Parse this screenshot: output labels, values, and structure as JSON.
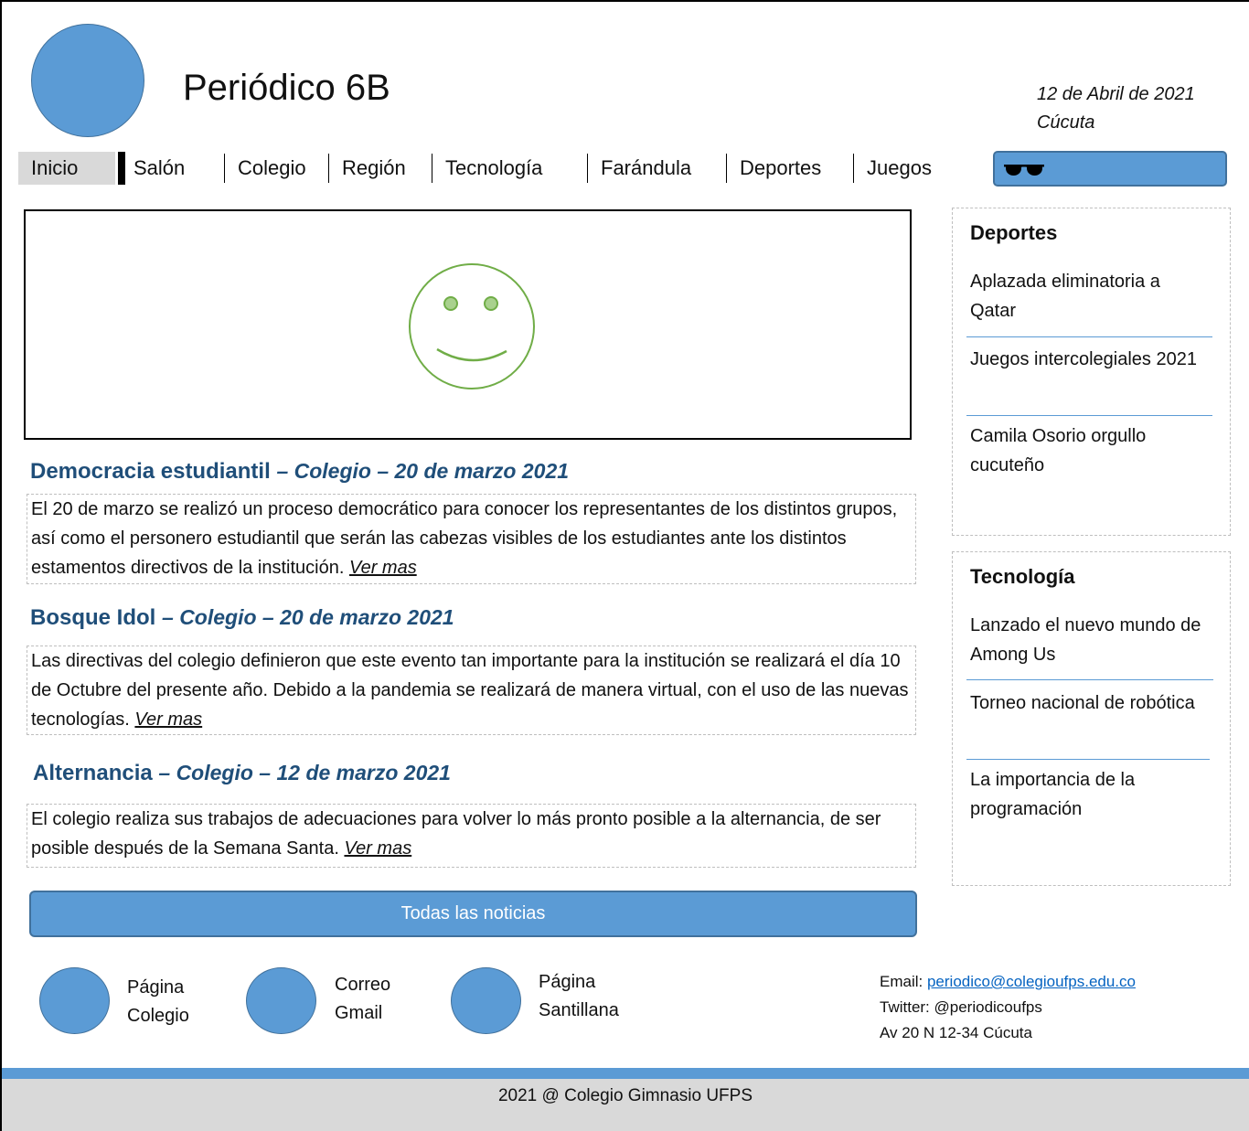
{
  "header": {
    "title": "Periódico 6B",
    "date": "12 de Abril de 2021",
    "city": "Cúcuta",
    "logo_icon": "circle-logo"
  },
  "nav": {
    "items": [
      "Inicio",
      "Salón",
      "Colegio",
      "Región",
      "Tecnología",
      "Farándula",
      "Deportes",
      "Juegos"
    ],
    "active": "Inicio"
  },
  "search": {
    "icon": "sunglasses-icon"
  },
  "hero": {
    "icon": "smiley-face-icon"
  },
  "news": [
    {
      "title": "Democracia estudiantil",
      "meta": "– Colegio – 20 de marzo 2021",
      "body": "El 20 de marzo se realizó un proceso democrático para conocer los representantes de los distintos grupos, así como el personero estudiantil que serán las cabezas visibles de los estudiantes ante los distintos estamentos directivos de la institución.",
      "more": "Ver mas"
    },
    {
      "title": "Bosque Idol",
      "meta": "– Colegio – 20 de marzo 2021",
      "body": "Las directivas del colegio definieron que este evento tan importante para la institución se realizará el día 10 de Octubre del presente año.  Debido a la pandemia se realizará de manera virtual, con el uso de las nuevas tecnologías.",
      "more": "Ver mas"
    },
    {
      "title": "Alternancia",
      "meta": "– Colegio – 12 de marzo 2021",
      "body": "El colegio realiza sus trabajos de adecuaciones para volver lo más pronto posible a la alternancia, de ser posible después de la Semana Santa.",
      "more": "Ver mas"
    }
  ],
  "all_news_button": "Todas las noticias",
  "sidebar": {
    "deportes": {
      "heading": "Deportes",
      "items": [
        "Aplazada eliminatoria a Qatar",
        "Juegos intercolegiales 2021",
        "Camila Osorio orgullo cucuteño"
      ]
    },
    "tecnologia": {
      "heading": "Tecnología",
      "items": [
        "Lanzado el nuevo mundo de Among Us",
        "Torneo nacional de robótica",
        "La importancia de la programación"
      ]
    }
  },
  "footer": {
    "links": [
      {
        "line1": "Página",
        "line2": "Colegio"
      },
      {
        "line1": "Correo",
        "line2": "Gmail"
      },
      {
        "line1": "Página",
        "line2": "Santillana"
      }
    ],
    "contact": {
      "email_label": "Email: ",
      "email": "periodico@colegioufps.edu.co",
      "twitter": "Twitter: @periodicoufps",
      "address": "Av 20 N 12-34 Cúcuta"
    },
    "copyright": "2021 @ Colegio Gimnasio UFPS"
  },
  "colors": {
    "accent": "#5b9bd5",
    "accent_border": "#41719c",
    "headline": "#1f4e79",
    "nav_active_bg": "#d9d9d9",
    "smiley": "#70ad47"
  }
}
